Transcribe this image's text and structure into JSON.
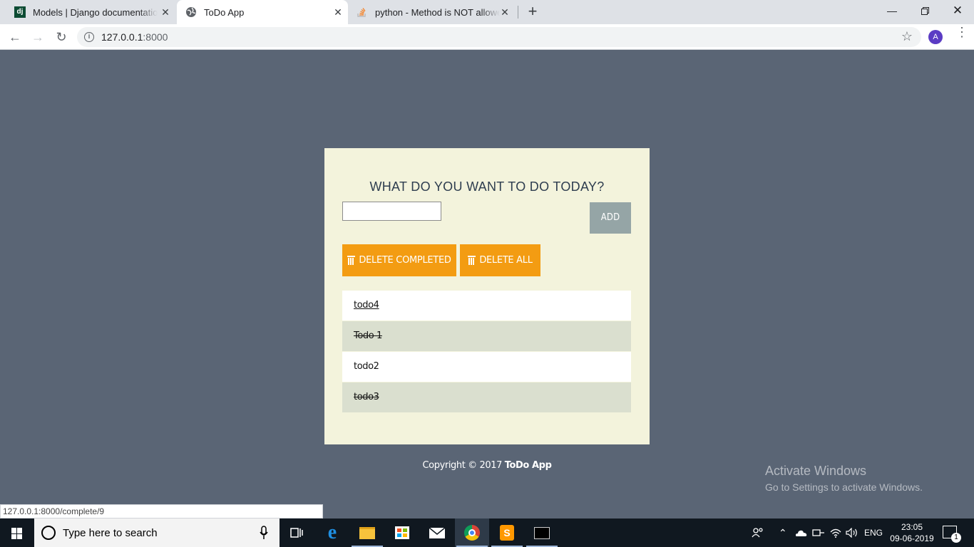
{
  "browser": {
    "tabs": [
      {
        "favicon": "django-favicon",
        "title": "Models | Django documentation | Django"
      },
      {
        "favicon": "globe-icon",
        "title": "ToDo App"
      },
      {
        "favicon": "stackoverflow-icon",
        "title": "python - Method is NOT allowed"
      }
    ],
    "address": {
      "host": "127.0.0.1",
      "port": ":8000"
    },
    "profile_initial": "A"
  },
  "page": {
    "heading": "WHAT DO YOU WANT TO DO TODAY?",
    "input_value": "",
    "add_label": "ADD",
    "delete_completed_label": "DELETE COMPLETED",
    "delete_all_label": "DELETE ALL",
    "todos": [
      {
        "text": "todo4",
        "completed": false
      },
      {
        "text": "Todo 1",
        "completed": true
      },
      {
        "text": "todo2",
        "completed": false
      },
      {
        "text": "todo3",
        "completed": true
      }
    ],
    "footer_prefix": "Copyright © 2017 ",
    "footer_brand": "ToDo App"
  },
  "status_url": "127.0.0.1:8000/complete/9",
  "watermark": {
    "title": "Activate Windows",
    "subtitle": "Go to Settings to activate Windows."
  },
  "taskbar": {
    "search_placeholder": "Type here to search",
    "language": "ENG",
    "time": "23:05",
    "date": "09-06-2019",
    "notification_count": "1"
  },
  "colors": {
    "page_bg": "#5a6575",
    "card_bg": "#f3f3dc",
    "accent_orange": "#f39c12",
    "add_button": "#95a5a6",
    "completed_row": "#dadfcf"
  }
}
